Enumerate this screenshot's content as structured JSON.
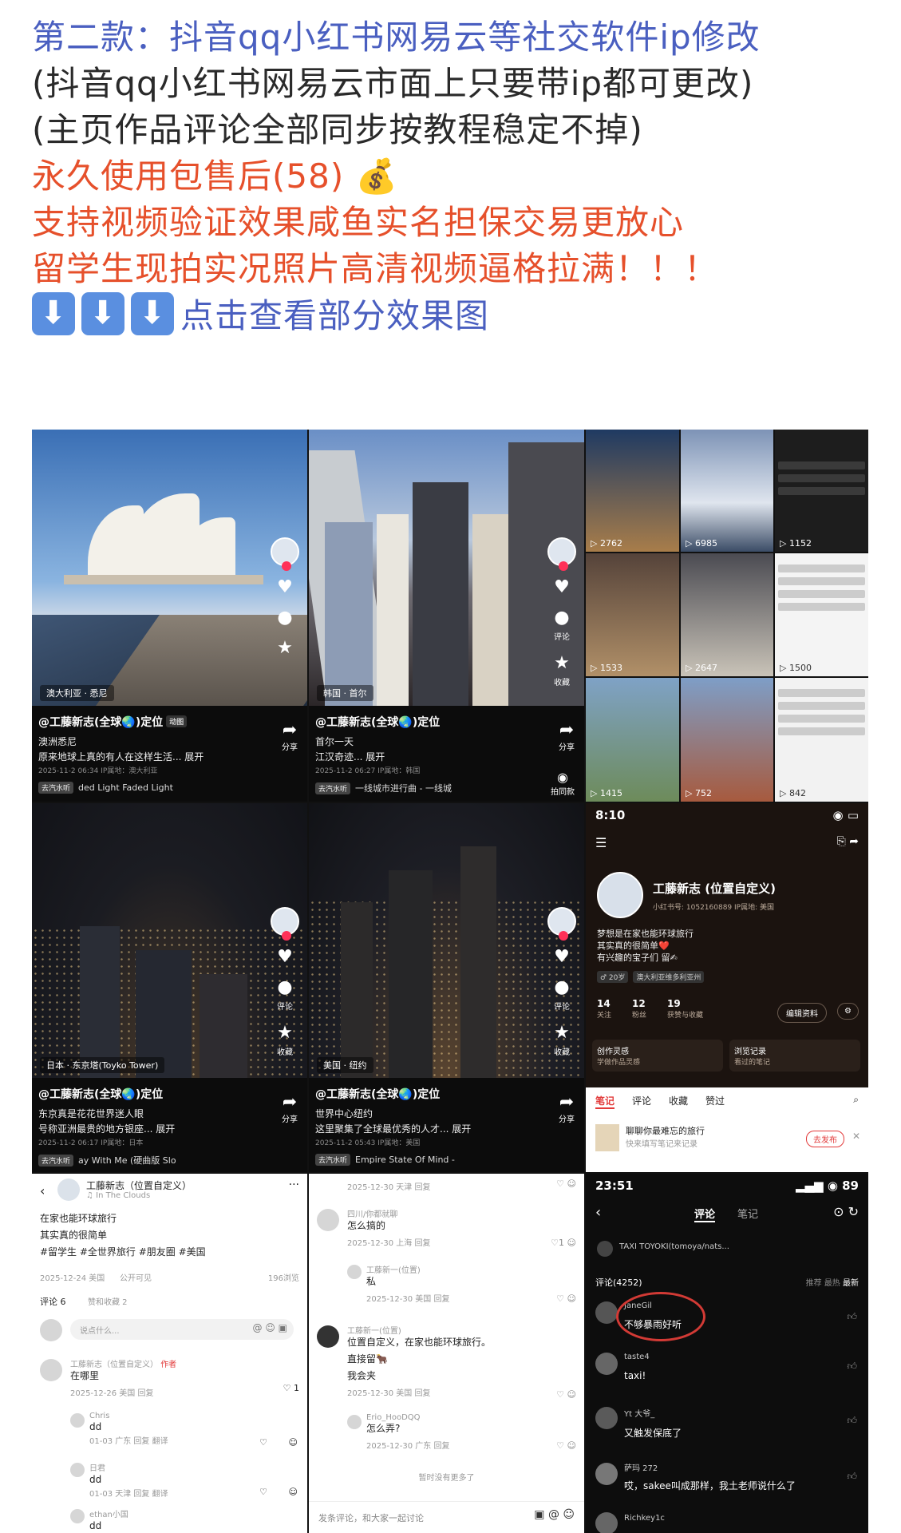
{
  "post": {
    "line1": "第二款：抖音qq小红书网易云等社交软件ip修改",
    "line2": "(抖音qq小红书网易云市面上只要带ip都可更改)",
    "line3": "(主页作品评论全部同步按教程稳定不掉)",
    "line4": "永久使用包售后(58) ",
    "line4_emoji": "💰",
    "line5": "支持视频验证效果咸鱼实名担保交易更放心",
    "line6": "留学生现拍实况照片高清视频逼格拉满！！！",
    "line7": "点击查看部分效果图"
  },
  "colors": {
    "blue": "#4a5fc0",
    "red": "#e6502b",
    "dark": "#2a2a2a",
    "emoji_bg": "#5a8fe0"
  },
  "panels": {
    "sydney": {
      "location": "澳大利亚 · 悉尼",
      "author": "@工藤新志(全球🌏)定位",
      "badge": "动图",
      "line1": "澳洲悉尼",
      "line2": "原来地球上真的有人在这样生活... 展开",
      "meta": "2025-11-2 06:34 IP属地：澳大利亚",
      "music_tag": "去汽水听",
      "music": "ded Light   Faded Light",
      "share": "分享"
    },
    "seoul": {
      "location": "韩国 · 首尔",
      "author": "@工藤新志(全球🌏)定位",
      "line1": "首尔一天",
      "line2": "江汉奇迹... 展开",
      "meta": "2025-11-2 06:27 IP属地：韩国",
      "music_tag": "去汽水听",
      "music": "一线城市进行曲 - 一线城",
      "share": "分享",
      "comment": "评论",
      "collect": "收藏",
      "shoot": "拍同款"
    },
    "tokyo": {
      "location": "日本 · 东京塔(Toyko Tower)",
      "author": "@工藤新志(全球🌏)定位",
      "line1": "东京真是花花世界迷人眼",
      "line2": "号称亚洲最贵的地方银座... 展开",
      "meta": "2025-11-2 06:17 IP属地：日本",
      "music_tag": "去汽水听",
      "music": "ay With Me (硬曲版 Slo",
      "share": "分享",
      "comment": "评论",
      "collect": "收藏"
    },
    "newyork": {
      "location": "美国 · 纽约",
      "author": "@工藤新志(全球🌏)定位",
      "line1": "世界中心纽约",
      "line2": "这里聚集了全球最优秀的人才... 展开",
      "meta": "2025-11-2 05:43 IP属地：美国",
      "music_tag": "去汽水听",
      "music": "Empire State Of Mind -",
      "share": "分享",
      "comment": "评论",
      "collect": "收藏"
    }
  },
  "thumbs": [
    "2762",
    "6985",
    "1152",
    "1533",
    "2647",
    "1500",
    "1415",
    "752",
    "842"
  ],
  "profile": {
    "time": "8:10",
    "name": "工藤新志 (位置自定义)",
    "id_line": "小红书号: 1052160889  IP属地: 美国",
    "bio1": "梦想是在家也能环球旅行",
    "bio2": "其实真的很简单❤️",
    "bio3": "有兴趣的宝子们 留✍",
    "age": "♂ 20岁",
    "region": "澳大利亚维多利亚州",
    "follow": "14",
    "follow_lbl": "关注",
    "fans": "12",
    "fans_lbl": "粉丝",
    "likes": "19",
    "likes_lbl": "获赞与收藏",
    "edit": "编辑资料",
    "card1": "创作灵感",
    "card1_sub": "学做作品灵感",
    "card2": "浏览记录",
    "card2_sub": "看过的笔记",
    "tabs": [
      "笔记",
      "评论",
      "收藏",
      "赞过"
    ],
    "promo": "聊聊你最难忘的旅行",
    "promo_sub": "快来填写笔记来记录",
    "promo_btn": "去发布"
  },
  "comments_left": {
    "author": "工藤新志（位置自定义）",
    "music": "♫ In The Clouds",
    "p1": "在家也能环球旅行",
    "p2": "其实真的很简单",
    "tags": "#留学生 #全世界旅行 #朋友圈 #美国",
    "date": "2025-12-24 美国",
    "visibility": "公开可见",
    "views": "196浏览",
    "count": "评论 6",
    "collect": "赞和收藏 2",
    "input": "说点什么...",
    "c1_name": "工藤新志（位置自定义）",
    "c1_badge": "作者",
    "c1_text": "在哪里",
    "c1_meta": "2025-12-26 美国  回复",
    "c1_likes": "1",
    "r1_name": "Chris",
    "r1_text": "dd",
    "r1_meta": "01-03 广东   回复  翻译",
    "r2_name": "日君",
    "r2_text": "dd",
    "r2_meta": "01-03 天津   回复  翻译",
    "r3_name": "ethan小国",
    "r3_text": "dd"
  },
  "comments_mid": {
    "top_meta": "2025-12-30 天津  回复",
    "c1_name": "四川/你都就聊",
    "c1_text": "怎么搞的",
    "c1_meta": "2025-12-30 上海  回复",
    "c1_likes": "1",
    "c2_name": "工藤新一(位置)",
    "c2_text": "私",
    "c2_meta": "2025-12-30 美国  回复",
    "c3_name": "工藤新一(位置)",
    "c3_text1": "位置自定义，在家也能环球旅行。",
    "c3_text2": "直接留🐂",
    "c3_text3": "我会夹",
    "c3_meta": "2025-12-30 美国  回复",
    "c4_name": "Erio_HooDQQ",
    "c4_text": "怎么弄?",
    "c4_meta": "2025-12-30 广东  回复",
    "end": "暂时没有更多了",
    "input": "发条评论，和大家一起讨论"
  },
  "comments_right": {
    "time": "23:51",
    "battery": "89",
    "tab1": "评论",
    "tab2": "笔记",
    "music": "TAXI   TOYOKI(tomoya/nats...",
    "count": "评论(4252)",
    "sort1": "推荐",
    "sort2": "最热",
    "sort3": "最新",
    "c1_name": "JaneGil",
    "c1_text": "不够暴雨好听",
    "c2_name": "taste4",
    "c2_text": "taxi!",
    "c3_name": "Yt 大爷_",
    "c3_text": "又触发保底了",
    "c4_name": "萨玛 272",
    "c4_text": "哎，sakee叫成那样，我土老师说什么了",
    "c5_name": "Richkey1c"
  }
}
